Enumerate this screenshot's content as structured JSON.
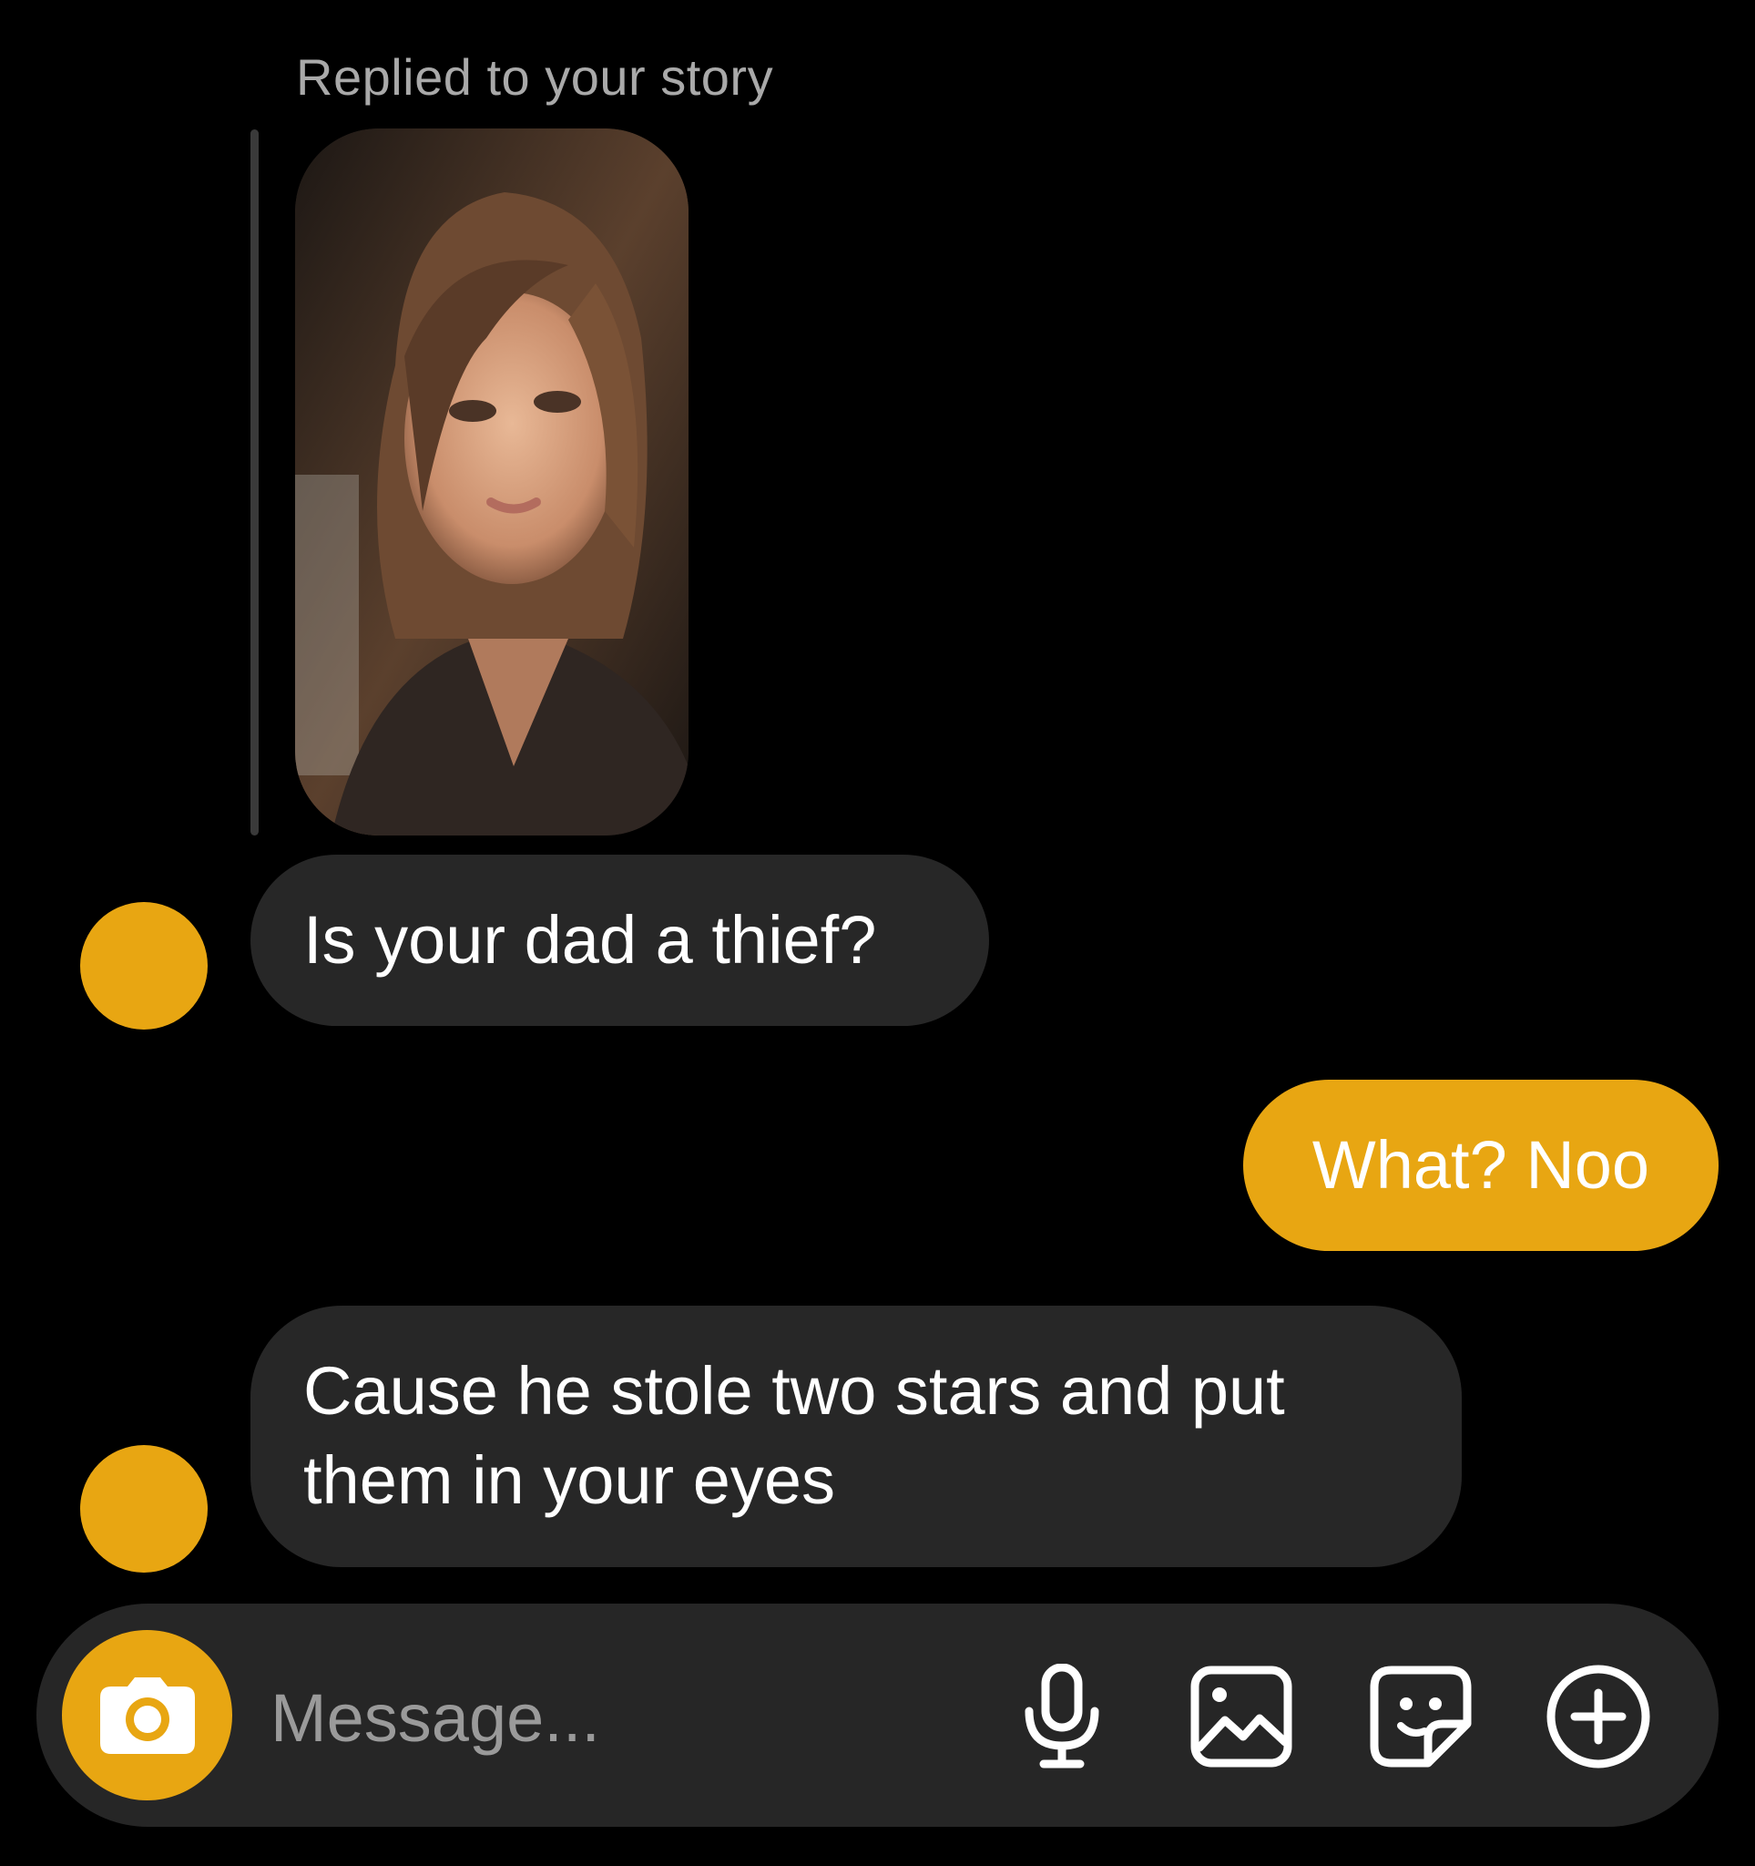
{
  "story_reply": {
    "label": "Replied to your story",
    "thumbnail": "story-photo-portrait"
  },
  "messages": [
    {
      "direction": "incoming",
      "text": "Is your dad a thief?"
    },
    {
      "direction": "outgoing",
      "text": "What? Noo"
    },
    {
      "direction": "incoming",
      "lines": [
        "Cause he stole two stars and put",
        "them in your eyes"
      ]
    }
  ],
  "composer": {
    "placeholder": "Message...",
    "icons": [
      "camera-icon",
      "microphone-icon",
      "gallery-icon",
      "sticker-icon",
      "plus-circle-icon"
    ]
  },
  "colors": {
    "background": "#000000",
    "accent": "#e8a612",
    "incoming_bubble": "#272727",
    "composer": "#262626",
    "muted_text": "#a9a9a9"
  }
}
